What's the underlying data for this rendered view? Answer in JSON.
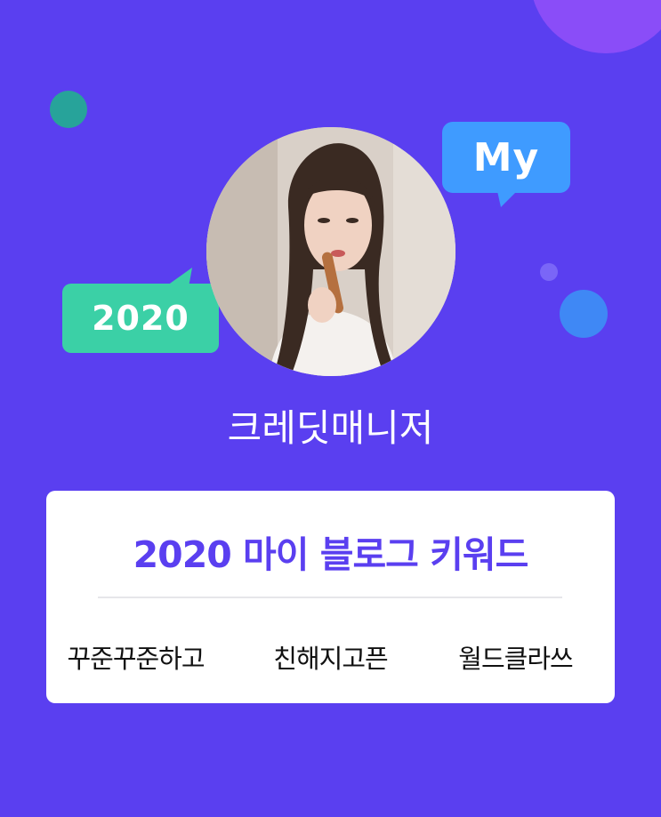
{
  "bubbles": {
    "my_label": "My",
    "year_label": "2020"
  },
  "profile": {
    "name": "크레딧매니저"
  },
  "card": {
    "title": "2020 마이 블로그 키워드",
    "keywords": [
      "꾸준꾸준하고",
      "친해지고픈",
      "월드클라쓰"
    ]
  },
  "colors": {
    "background": "#5a3ff0",
    "title_text": "#5a3ff0",
    "my_bubble": "#3f9bff",
    "year_bubble": "#3bd0a6"
  }
}
